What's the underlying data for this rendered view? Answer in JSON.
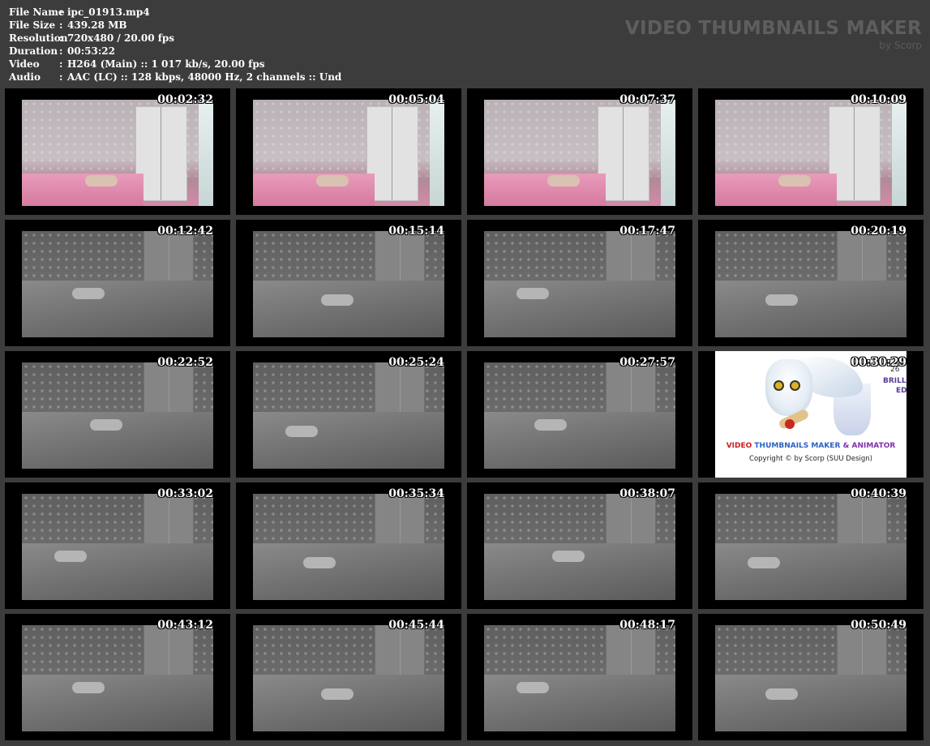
{
  "info": {
    "rows": [
      {
        "label": "File Name",
        "sep": ":",
        "value": "ipc_01913.mp4"
      },
      {
        "label": "File Size",
        "sep": ":",
        "value": "439.28 MB"
      },
      {
        "label": "Resolution",
        "sep": ":",
        "value": "720x480 / 20.00 fps"
      },
      {
        "label": "Duration",
        "sep": ":",
        "value": "00:53:22"
      },
      {
        "label": "Video",
        "sep": ":",
        "value": "H264 (Main) :: 1 017 kb/s, 20.00 fps"
      },
      {
        "label": "Audio",
        "sep": ":",
        "value": "AAC (LC) :: 128 kbps, 48000 Hz, 2 channels :: Und"
      }
    ]
  },
  "brand": {
    "title": "VIDEO THUMBNAILS MAKER",
    "subtitle": "by Scorp"
  },
  "thumbnails": [
    {
      "time": "00:02:32",
      "scene": "day"
    },
    {
      "time": "00:05:04",
      "scene": "day"
    },
    {
      "time": "00:07:37",
      "scene": "day"
    },
    {
      "time": "00:10:09",
      "scene": "day"
    },
    {
      "time": "00:12:42",
      "scene": "night"
    },
    {
      "time": "00:15:14",
      "scene": "night"
    },
    {
      "time": "00:17:47",
      "scene": "night"
    },
    {
      "time": "00:20:19",
      "scene": "night"
    },
    {
      "time": "00:22:52",
      "scene": "night"
    },
    {
      "time": "00:25:24",
      "scene": "night"
    },
    {
      "time": "00:27:57",
      "scene": "night"
    },
    {
      "time": "00:30:29",
      "scene": "logo"
    },
    {
      "time": "00:33:02",
      "scene": "night"
    },
    {
      "time": "00:35:34",
      "scene": "night"
    },
    {
      "time": "00:38:07",
      "scene": "night"
    },
    {
      "time": "00:40:39",
      "scene": "night"
    },
    {
      "time": "00:43:12",
      "scene": "night"
    },
    {
      "time": "00:45:44",
      "scene": "night"
    },
    {
      "time": "00:48:17",
      "scene": "night"
    },
    {
      "time": "00:50:49",
      "scene": "night"
    }
  ],
  "logo_card": {
    "partial_1": "26",
    "partial_2": "BRILL",
    "partial_3": "ED",
    "title_part1": "VIDEO",
    "title_part2": " THUMBNAILS MAKER",
    "title_part3": " & ANIMATOR",
    "copyright": "Copyright © by Scorp (SUU Design)"
  },
  "colors": {
    "background": "#3c3c3c",
    "thumb_bg": "#000000",
    "brand_text": "#5e5e5e",
    "overlay_text": "#e2e800"
  }
}
